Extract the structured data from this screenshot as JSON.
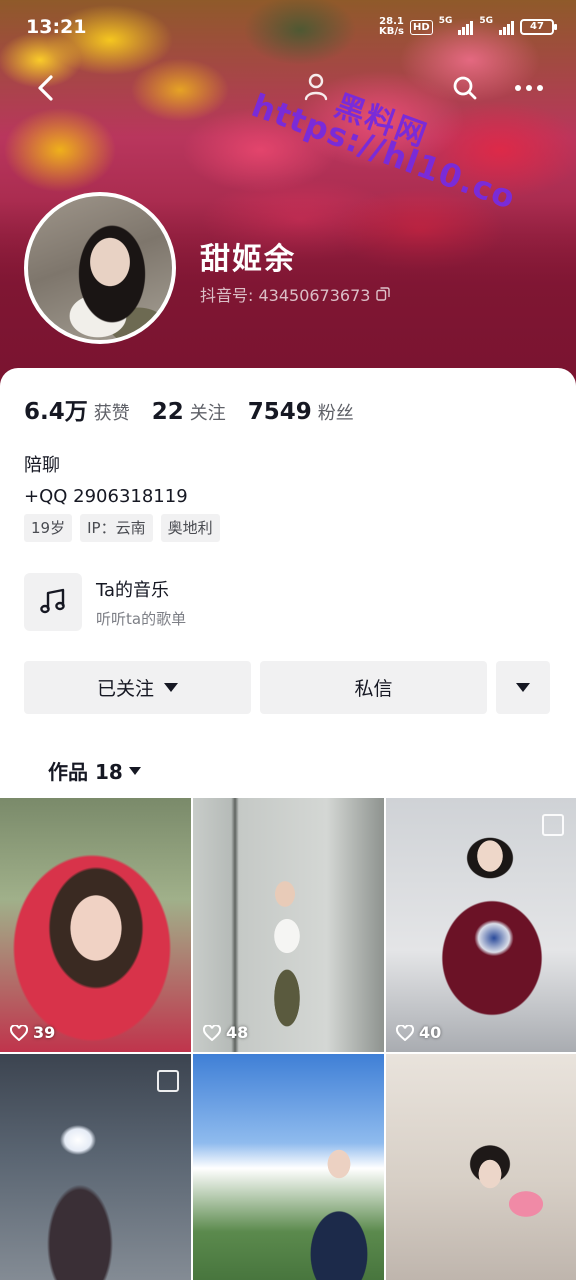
{
  "status_bar": {
    "time": "13:21",
    "net_speed_value": "28.1",
    "net_speed_unit": "KB/s",
    "hd_label": "HD",
    "sim1_label": "5G",
    "sim2_label": "5G",
    "battery": "47"
  },
  "watermark": {
    "name": "黑料网",
    "url": "https://hl10.co"
  },
  "profile": {
    "name": "甜姬余",
    "douyin_id": "抖音号: 43450673673"
  },
  "stats": [
    {
      "num": "6.4万",
      "label": "获赞"
    },
    {
      "num": "22",
      "label": "关注"
    },
    {
      "num": "7549",
      "label": "粉丝"
    }
  ],
  "bio": {
    "line1": "陪聊",
    "line2": "+QQ 2906318119"
  },
  "tags": [
    "19岁",
    "IP：云南",
    "奥地利"
  ],
  "music": {
    "title": "Ta的音乐",
    "subtitle": "听听ta的歌单"
  },
  "actions": {
    "follow": "已关注",
    "message": "私信"
  },
  "works": {
    "label": "作品 18"
  },
  "videos": [
    {
      "likes": "39",
      "multi": false
    },
    {
      "likes": "48",
      "multi": false
    },
    {
      "likes": "40",
      "multi": true
    },
    {
      "likes": "",
      "multi": true
    },
    {
      "likes": "",
      "multi": false
    },
    {
      "likes": "",
      "multi": false
    }
  ],
  "colors": {
    "cover_bottom": "#7a1430",
    "button_bg": "#f1f1f2",
    "text_primary": "#161823",
    "text_secondary": "#5f6168"
  }
}
